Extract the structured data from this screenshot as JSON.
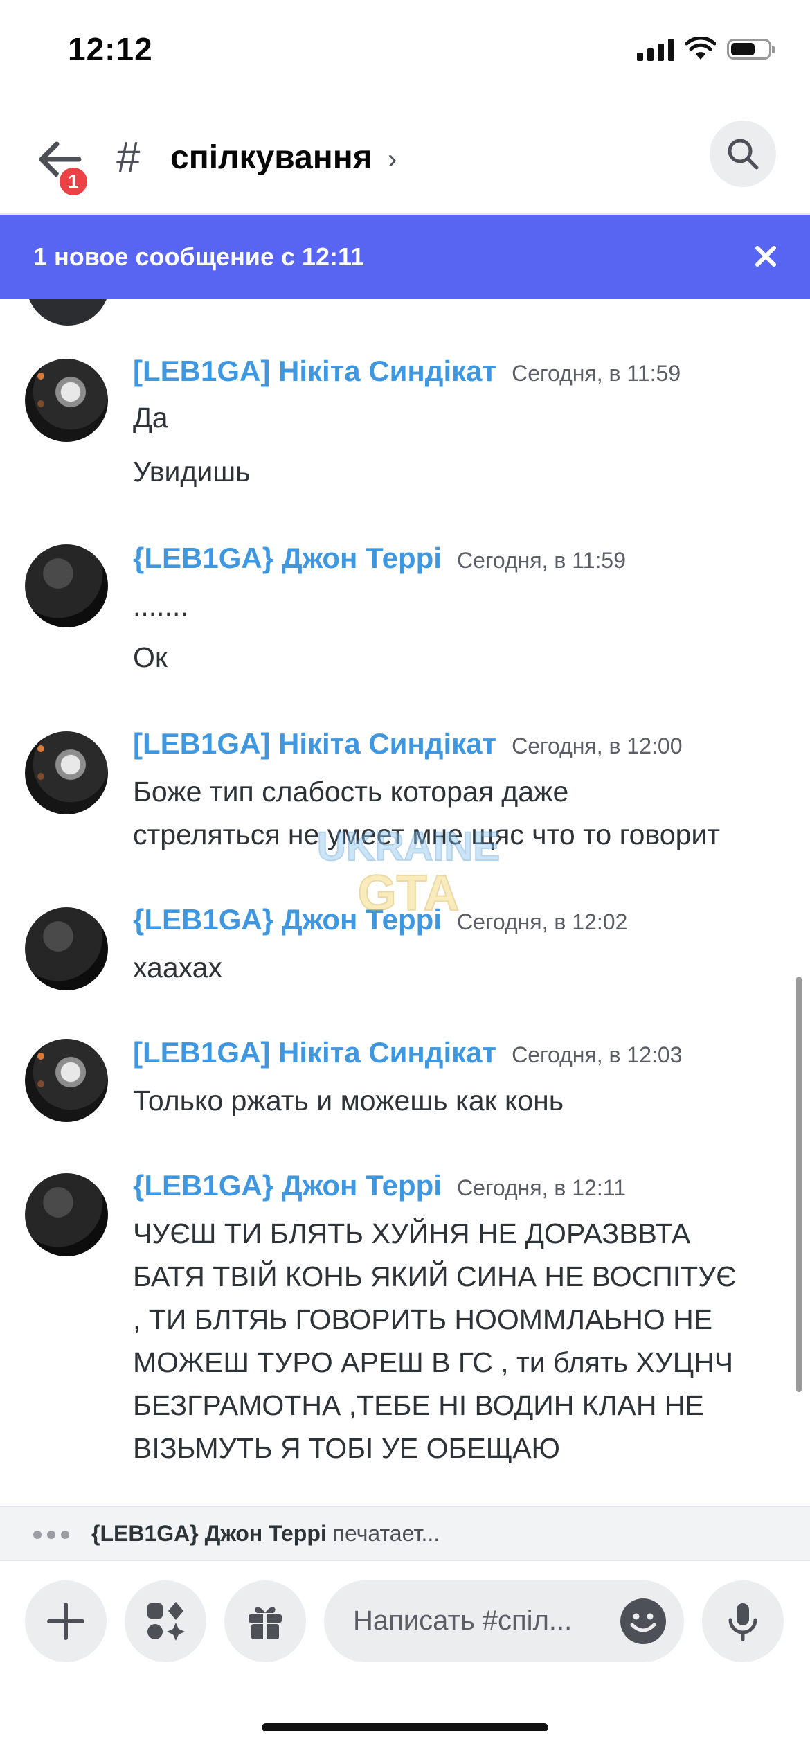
{
  "status_bar": {
    "time": "12:12"
  },
  "header": {
    "notification_count": "1",
    "channel_hash": "#",
    "channel_name": "спілкування",
    "chevron": "›"
  },
  "banner": {
    "text": "1 новое сообщение с 12:11"
  },
  "messages": [
    {
      "author": "[LEB1GA] Нікіта Синдікат",
      "timestamp": "Сегодня, в 11:59",
      "lines": [
        "Да",
        "Увидишь"
      ]
    },
    {
      "author": "{LEB1GA} Джон Террі",
      "timestamp": "Сегодня, в 11:59",
      "lines": [
        ".......",
        "Ок"
      ]
    },
    {
      "author": "[LEB1GA] Нікіта Синдікат",
      "timestamp": "Сегодня, в 12:00",
      "lines": [
        "Боже тип слабость которая даже",
        "стреляться не умеет мне щяс что то говорит"
      ]
    },
    {
      "author": "{LEB1GA} Джон Террі",
      "timestamp": "Сегодня, в 12:02",
      "lines": [
        "хаахах"
      ]
    },
    {
      "author": "[LEB1GA] Нікіта Синдікат",
      "timestamp": "Сегодня, в 12:03",
      "lines": [
        "Только ржать и можешь как конь"
      ]
    },
    {
      "author": "{LEB1GA} Джон Террі",
      "timestamp": "Сегодня, в 12:11",
      "lines": [
        "ЧУЄШ ТИ БЛЯТЬ ХУЙНЯ НЕ ДОРАЗВВТА",
        "БАТЯ ТВІЙ КОНЬ ЯКИЙ СИНА НЕ ВОСПІТУЄ",
        ", ТИ БЛТЯЬ ГОВОРИТЬ НООММЛАЬНО НЕ",
        "МОЖЕШ ТУРО АРЕШ В ГС , ти блять ХУЦНЧ",
        "БЕЗГРАМОТНА ,ТЕБЕ НІ ВОДИН КЛАН НЕ",
        "ВІЗЬМУТЬ Я ТОБІ УЕ ОБЕЩАЮ"
      ]
    }
  ],
  "typing": {
    "user": "{LEB1GA} Джон Террі",
    "suffix": " печатает..."
  },
  "composer": {
    "placeholder": "Написать #спіл..."
  },
  "watermark": {
    "line1": "UKRAINE",
    "line2": "GTA"
  },
  "icons": {
    "back": "arrow-left-icon",
    "search": "search-icon",
    "close": "close-icon",
    "plus": "plus-icon",
    "apps": "apps-icon",
    "gift": "gift-icon",
    "emoji": "emoji-icon",
    "mic": "microphone-icon"
  },
  "colors": {
    "accent": "#5865f2",
    "author": "#3f97e0",
    "badge": "#ed4245"
  }
}
